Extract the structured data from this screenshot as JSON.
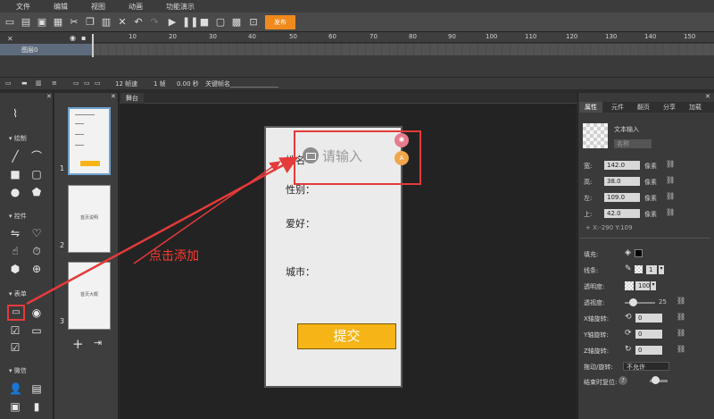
{
  "menu": [
    "文件",
    "编辑",
    "视图",
    "动画",
    "功能演示"
  ],
  "toolbar": {
    "publish_label": "发布"
  },
  "timeline": {
    "ruler": [
      "10",
      "20",
      "30",
      "40",
      "50",
      "60",
      "70",
      "80",
      "90",
      "100",
      "110",
      "120",
      "130",
      "140",
      "150"
    ],
    "layer_name": "图层0",
    "footer": {
      "fps": "12 帧速",
      "frame": "1 帧",
      "time": "0.00 秒",
      "frame_name_label": "关键帧名"
    }
  },
  "tools": {
    "sections": [
      "绘制",
      "控件",
      "表单",
      "微信"
    ]
  },
  "pages": {
    "items": [
      {
        "num": "1",
        "text": ""
      },
      {
        "num": "2",
        "text": "首页说明"
      },
      {
        "num": "3",
        "text": "首页大概"
      }
    ]
  },
  "stage": {
    "tab": "舞台",
    "fields": [
      "姓名：",
      "性别：",
      "爱好：",
      "城市："
    ],
    "name_partial": "姓名",
    "input_placeholder": "请输入",
    "submit_label": "提交",
    "badge_aa": "A"
  },
  "annotation": "点击添加",
  "props": {
    "tabs": [
      "属性",
      "元件",
      "翻页",
      "分享",
      "加载"
    ],
    "element_type": "文本输入",
    "name_placeholder": "名称",
    "width_label": "宽:",
    "width": "142.0",
    "height_label": "高:",
    "height": "38.0",
    "left_label": "左:",
    "left": "109.0",
    "top_label": "上:",
    "top": "42.0",
    "unit": "像素",
    "coords": "X:-290   Y:109",
    "fill_label": "填充:",
    "stroke_label": "线条:",
    "stroke_value": "1",
    "opacity_label": "透明度:",
    "opacity_value": "100",
    "blur_label": "透视度:",
    "blur_value": "25",
    "xrot_label": "X轴旋转:",
    "xrot_value": "0",
    "yrot_label": "Y轴旋转:",
    "yrot_value": "0",
    "zrot_label": "Z轴旋转:",
    "zrot_value": "0",
    "drag_label": "拖动/旋转:",
    "drag_value": "不允许",
    "reset_label": "结束时复位:"
  }
}
